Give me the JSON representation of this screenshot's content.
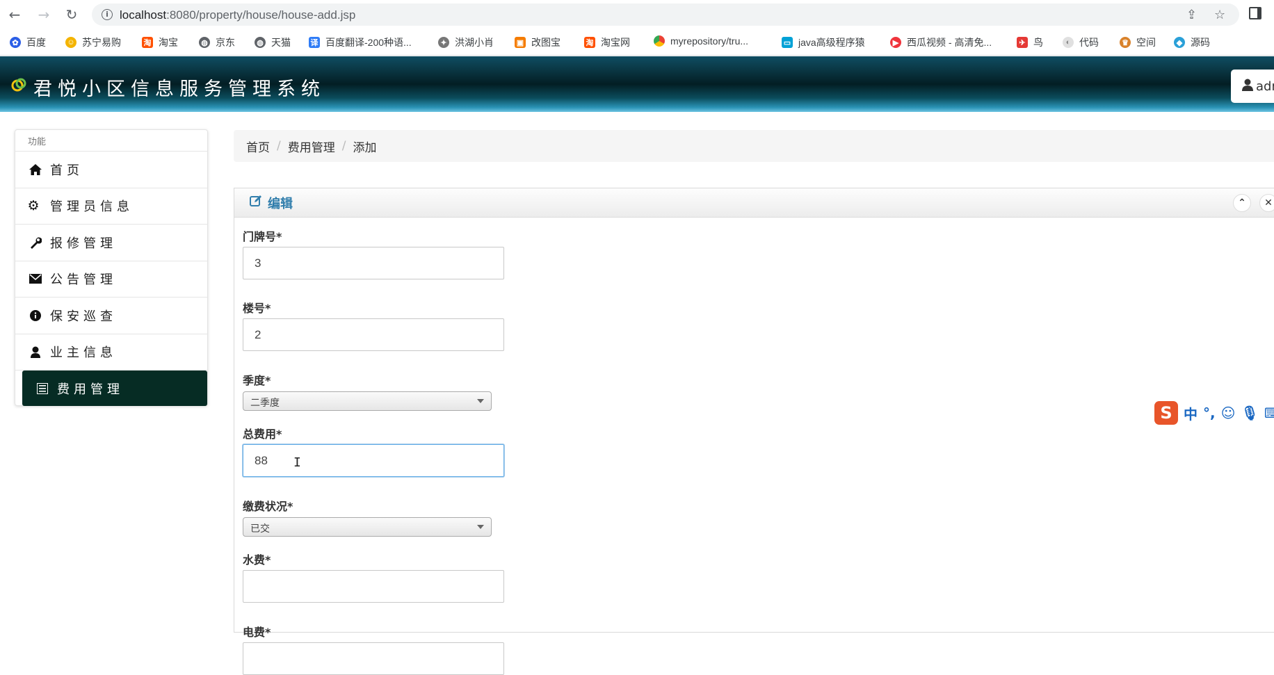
{
  "browser": {
    "url_host": "localhost",
    "url_rest": ":8080/property/house/house-add.jsp",
    "bookmarks": [
      "百度",
      "苏宁易购",
      "淘宝",
      "京东",
      "天猫",
      "百度翻译-200种语...",
      "洪湖小肖",
      "改图宝",
      "淘宝网",
      "myrepository/tru...",
      "java高级程序猿",
      "西瓜视频 - 高清免...",
      "鸟",
      "代码",
      "空间",
      "源码"
    ]
  },
  "header": {
    "title": "君悦小区信息服务管理系统",
    "user_label": "adm"
  },
  "sidebar": {
    "heading": "功能",
    "items": [
      {
        "label": "首页",
        "icon": "home-icon"
      },
      {
        "label": "管理员信息",
        "icon": "gear-icon"
      },
      {
        "label": "报修管理",
        "icon": "wrench-icon"
      },
      {
        "label": "公告管理",
        "icon": "envelope-icon"
      },
      {
        "label": "保安巡查",
        "icon": "info-icon"
      },
      {
        "label": "业主信息",
        "icon": "user-icon"
      },
      {
        "label": "费用管理",
        "icon": "list-icon",
        "active": true
      }
    ]
  },
  "breadcrumb": [
    "首页",
    "费用管理",
    "添加"
  ],
  "panel": {
    "title": "编辑"
  },
  "form": {
    "door_number": {
      "label": "门牌号*",
      "value": "3"
    },
    "building": {
      "label": "楼号*",
      "value": "2"
    },
    "season": {
      "label": "季度*",
      "value": "二季度"
    },
    "total_fee": {
      "label": "总费用*",
      "value": "88"
    },
    "payment_status": {
      "label": "缴费状况*",
      "value": "已交"
    },
    "water_fee": {
      "label": "水费*",
      "value": ""
    },
    "electric_fee": {
      "label": "电费*"
    }
  },
  "ime": {
    "mode": "中",
    "punct": "°,"
  },
  "colors": {
    "active_nav": "#062c24",
    "panel_title": "#317eac",
    "ime_brand": "#e8552a"
  }
}
